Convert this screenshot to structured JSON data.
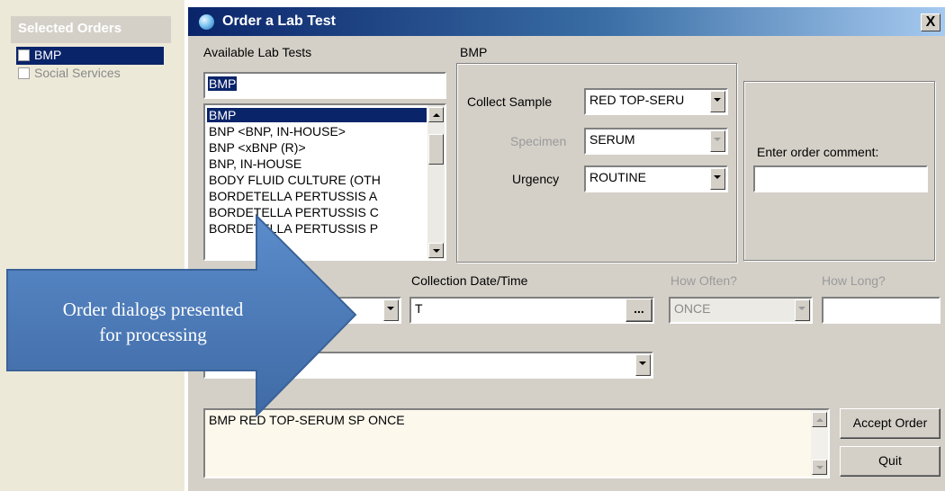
{
  "selected_orders": {
    "header": "Selected Orders",
    "items": [
      {
        "label": "BMP",
        "state": "selected"
      },
      {
        "label": "Social Services",
        "state": "disabled"
      }
    ]
  },
  "dialog": {
    "title": "Order a Lab Test",
    "close_label": "X",
    "available_tests": {
      "label": "Available Lab Tests",
      "search_value": "BMP",
      "items": [
        "BMP",
        "BNP      <BNP, IN-HOUSE>",
        "BNP      <xBNP (R)>",
        "BNP, IN-HOUSE",
        "BODY FLUID CULTURE (OTH",
        "BORDETELLA PERTUSSIS A",
        "BORDETELLA PERTUSSIS C",
        "BORDETELLA PERTUSSIS P"
      ],
      "selected_index": 0
    },
    "test_panel": {
      "heading": "BMP",
      "collect_sample_label": "Collect Sample",
      "collect_sample_value": "RED TOP-SERU",
      "specimen_label": "Specimen",
      "specimen_value": "SERUM",
      "urgency_label": "Urgency",
      "urgency_value": "ROUTINE",
      "comment_label": "Enter order comment:",
      "comment_value": ""
    },
    "collection": {
      "type_value": "",
      "datetime_label": "Collection Date/Time",
      "datetime_value": "T",
      "browse_label": "...",
      "how_often_label": "How Often?",
      "how_often_value": "ONCE",
      "how_long_label": "How Long?",
      "how_long_value": ""
    },
    "secondary_select_value": "",
    "order_summary": "BMP RED TOP-SERUM   SP ONCE",
    "accept_label": "Accept Order",
    "quit_label": "Quit"
  },
  "callout": {
    "line1": "Order dialogs presented",
    "line2": "for processing",
    "color": "#4f7fbb"
  }
}
